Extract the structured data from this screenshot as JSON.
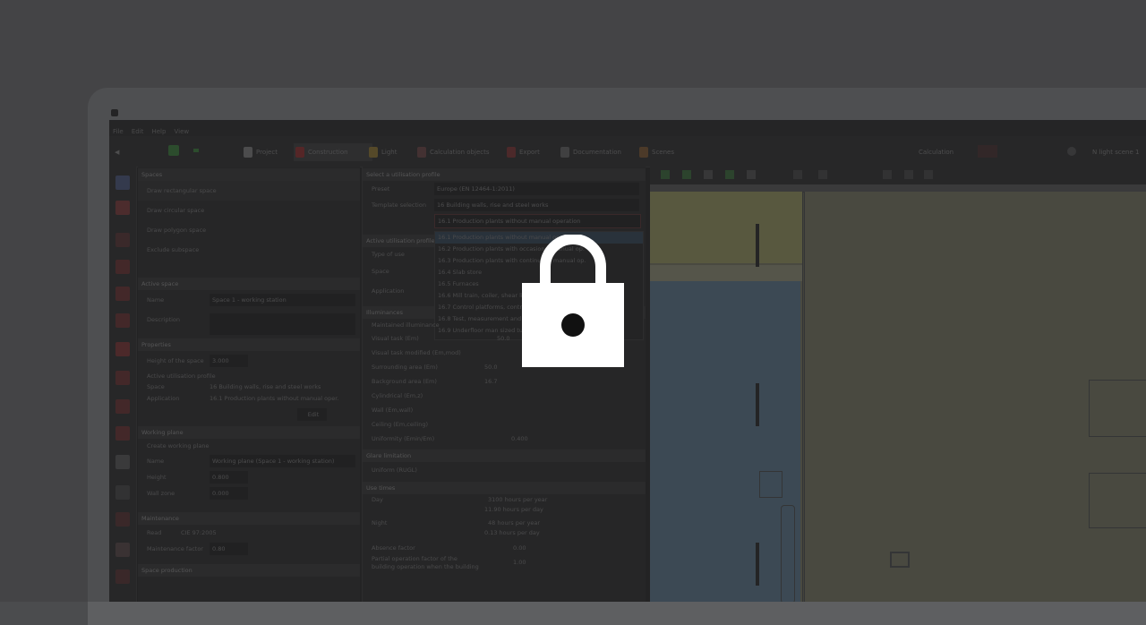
{
  "menubar": {
    "items": [
      "File",
      "Edit",
      "Help",
      "View"
    ]
  },
  "ribbon": {
    "tabs": [
      {
        "label": "Project",
        "color": "#7a7a7a"
      },
      {
        "label": "Construction",
        "color": "#9a1818",
        "active": true
      },
      {
        "label": "Light",
        "color": "#b08a2a"
      },
      {
        "label": "Calculation objects",
        "color": "#7a4040"
      },
      {
        "label": "Export",
        "color": "#8a2a2a"
      },
      {
        "label": "Documentation",
        "color": "#6a6a6a"
      },
      {
        "label": "Scenes",
        "color": "#8a5a2a"
      }
    ],
    "calc_label": "Calculation",
    "scale_label": "N light scene 1"
  },
  "left_panel": {
    "spaces_title": "Spaces",
    "tools": [
      "Draw rectangular space",
      "Draw circular space",
      "Draw polygon space",
      "Exclude subspace"
    ],
    "active_space_title": "Active space",
    "name_label": "Name",
    "name_value": "Space 1 - working station",
    "desc_label": "Description",
    "properties_title": "Properties",
    "height_label": "Height of the space",
    "height_value": "3.000",
    "util_title": "Active utilisation profile",
    "space_label": "Space",
    "space_value": "16 Building walls, rise and steel works",
    "app_label": "Application",
    "app_value": "16.1 Production plants without manual oper.",
    "edit_label": "Edit",
    "working_plane_title": "Working plane",
    "create_wp_label": "Create working plane",
    "wp_name_label": "Name",
    "wp_name_value": "Working plane (Space 1 - working station)",
    "wp_height_label": "Height",
    "wp_height_value": "0.800",
    "wall_zone_label": "Wall zone",
    "wall_zone_value": "0.000",
    "maintenance_title": "Maintenance",
    "read_label": "Read",
    "read_value": "CIE 97:2005",
    "mf_label": "Maintenance factor",
    "mf_value": "0.80",
    "space_prop_title": "Space production"
  },
  "mid_panel": {
    "select_title": "Select a utilisation profile",
    "preset_label": "Preset",
    "preset_value": "Europe (EN 12464-1:2011)",
    "template_label": "Template selection",
    "template_value": "16 Building walls, rise and steel works",
    "dropdown_selected": "16.1 Production plants without manual operation",
    "dropdown_items": [
      "16.1 Production plants without manual operation",
      "16.2 Production plants with occasional manual op.",
      "16.3 Production plants with continuous manual op.",
      "16.4 Slab store",
      "16.5 Furnaces",
      "16.6 Mill train, coiler, shear line",
      "16.7 Control platforms, control panels",
      "16.8 Test, measurement and inspection",
      "16.9 Underfloor man sized tunnels"
    ],
    "active_util_title": "Active utilisation profile",
    "type_label": "Type of use",
    "space_label": "Space",
    "application_label": "Application",
    "illum_title": "Illuminances",
    "maint_illum_label": "Maintained illuminance",
    "visual_task_label": "Visual task (Em)",
    "visual_task_value": "50.0",
    "visual_task_mod_label": "Visual task modified (Em,mod)",
    "surround_label": "Surrounding area (Em)",
    "surround_value": "50.0",
    "background_label": "Background area (Em)",
    "background_value": "16.7",
    "cyl_label": "Cylindrical (Em,z)",
    "wall_label": "Wall (Em,wall)",
    "ceiling_label": "Ceiling (Em,ceiling)",
    "uniformity_label": "Uniformity (Emin/Em)",
    "uniformity_value": "0.400",
    "glare_title": "Glare limitation",
    "ugr_label": "Uniform (RUGL)",
    "use_times_title": "Use times",
    "day_label": "Day",
    "day_value": "3100",
    "day_unit": "hours per year",
    "day_sub": "11.90 hours per day",
    "night_label": "Night",
    "night_value": "48",
    "night_unit": "hours per year",
    "night_sub": "0.13 hours per day",
    "absence_label": "Absence factor",
    "absence_value": "0.00",
    "partial_label": "Partial operation factor of the building operation when the building",
    "partial_value": "1.00"
  },
  "lock": {
    "icon": "lock-icon"
  }
}
